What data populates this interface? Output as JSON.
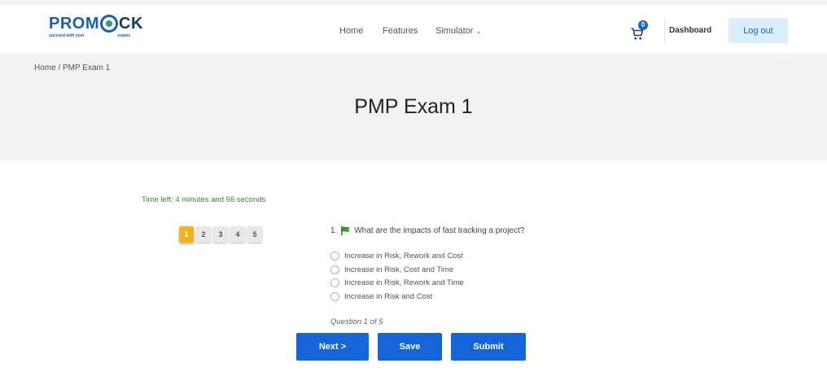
{
  "header": {
    "logo_main_pro": "PROM",
    "logo_main_ck": "CK",
    "logo_sub_left": "succeed with your",
    "logo_sub_right": "exams",
    "nav": {
      "home": "Home",
      "features": "Features",
      "simulator": "Simulator"
    },
    "cart_count": "0",
    "dashboard": "Dashboard",
    "logout": "Log out"
  },
  "breadcrumb": "Home  /  PMP Exam 1",
  "page_title": "PMP Exam 1",
  "quiz": {
    "timer": "Time left: 4 minutes and 56 seconds",
    "question_numbers": [
      "1",
      "2",
      "3",
      "4",
      "5"
    ],
    "active_question": "1",
    "question_prefix": "1.",
    "question_text": "What are the impacts of fast tracking a project?",
    "options": [
      "Increase in Risk, Rework and Cost",
      "Increase in Risk, Cost and Time",
      "Increase in Risk, Rework and Time",
      "Increase in Risk and Cost"
    ],
    "counter": "Question 1 of 5",
    "buttons": {
      "next": "Next >",
      "save": "Save",
      "submit": "Submit"
    }
  },
  "colors": {
    "primary": "#1565d8",
    "timer": "#3a8a2e",
    "active_question": "#f6b21c",
    "flag": "#2e9e2e"
  }
}
